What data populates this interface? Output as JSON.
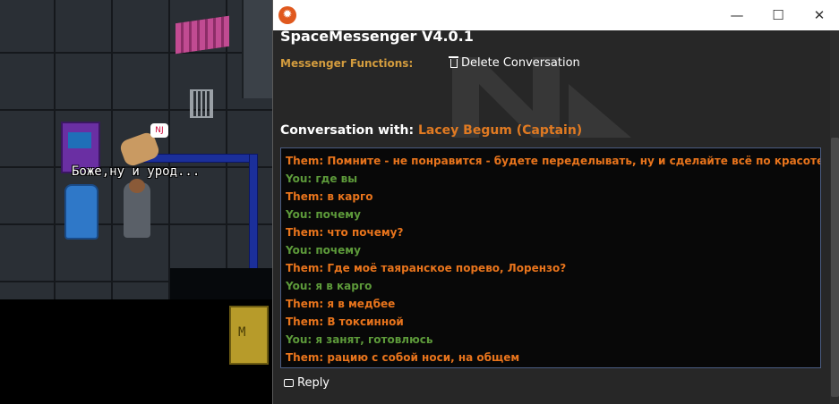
{
  "game": {
    "speech_bubble": "Боже,ну и урод...",
    "emote_text": "NJ",
    "door_sign": "M"
  },
  "window": {
    "icon": "spacemessenger-logo-icon",
    "controls": {
      "minimize": "—",
      "maximize": "☐",
      "close": "✕"
    }
  },
  "messenger": {
    "title": "SpaceMessenger V4.0.1",
    "functions_label": "Messenger Functions:",
    "delete_label": "Delete Conversation",
    "conversation_label": "Conversation with:",
    "contact": "Lacey Begum (Captain)",
    "reply_label": "Reply",
    "messages": [
      {
        "from": "them",
        "text": "Them: Помните - не понравится - будете переделывать, ну и сделайте всё по красоте"
      },
      {
        "from": "you",
        "text": "You: где вы"
      },
      {
        "from": "them",
        "text": "Them: в карго"
      },
      {
        "from": "you",
        "text": "You: почему"
      },
      {
        "from": "them",
        "text": "Them: что почему?"
      },
      {
        "from": "you",
        "text": "You: почему"
      },
      {
        "from": "them",
        "text": "Them: Где моё таяранское порево, Лорензо?"
      },
      {
        "from": "you",
        "text": "You: я в карго"
      },
      {
        "from": "them",
        "text": "Them: я в медбее"
      },
      {
        "from": "them",
        "text": "Them: В токсинной"
      },
      {
        "from": "you",
        "text": "You: я занят, готовлюсь"
      },
      {
        "from": "them",
        "text": "Them: рацию с собой носи, на общем"
      }
    ]
  },
  "colors": {
    "them": "#e8741c",
    "you": "#5d9a3a",
    "label_orange": "#d39c3e",
    "contact": "#e07a22",
    "window_bg": "#272727"
  }
}
